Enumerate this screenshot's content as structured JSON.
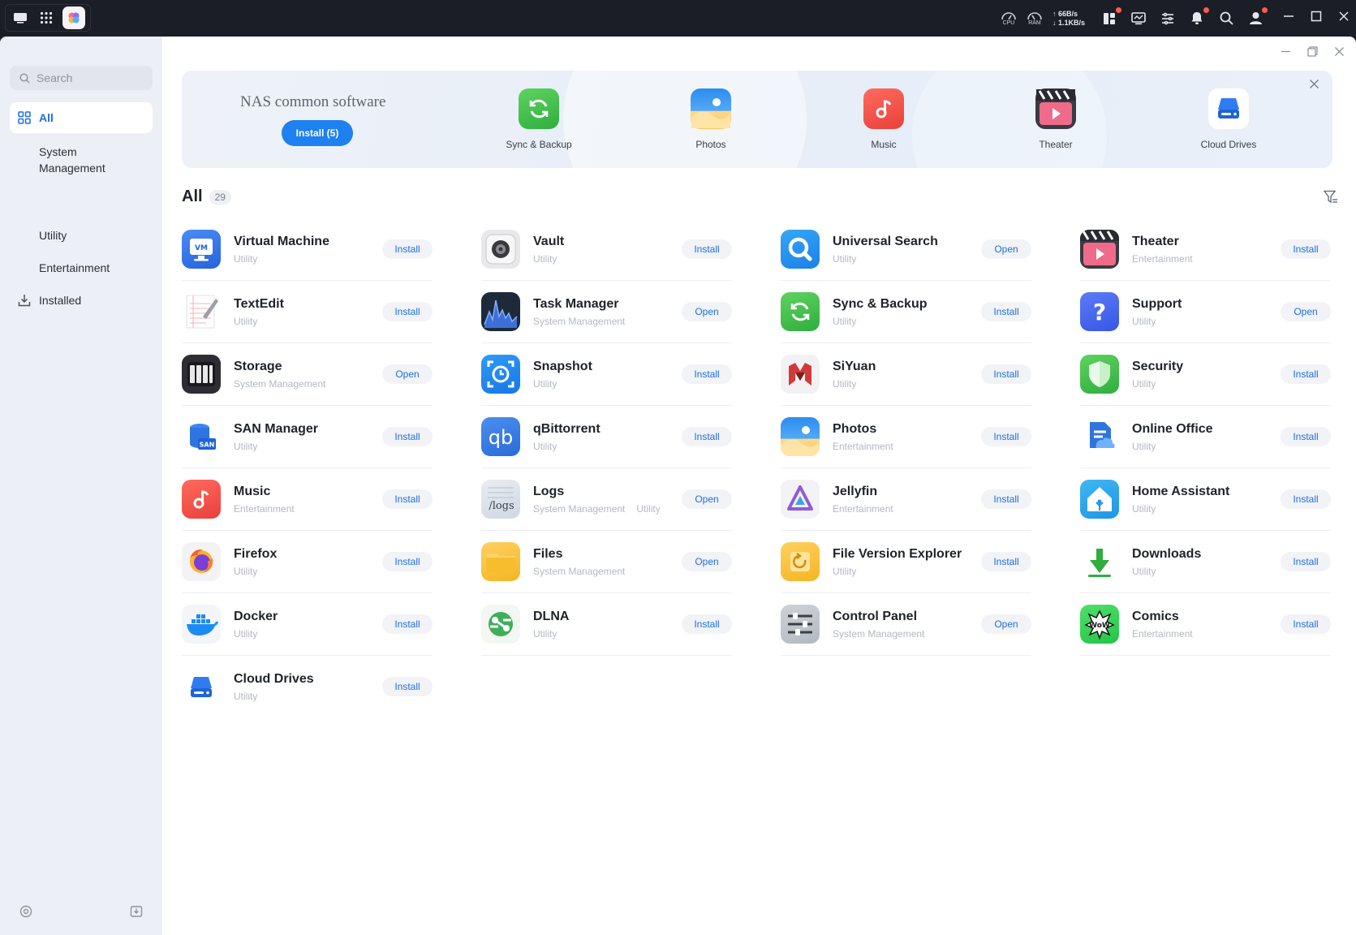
{
  "taskbar": {
    "cpu_label": "CPU",
    "ram_label": "RAM",
    "net_up": "↑ 66B/s",
    "net_down": "↓ 1.1KB/s"
  },
  "sidebar": {
    "search_placeholder": "Search",
    "items": [
      {
        "label": "All"
      },
      {
        "label": "System Management"
      },
      {
        "label": "Utility"
      },
      {
        "label": "Entertainment"
      },
      {
        "label": "Installed"
      }
    ]
  },
  "banner": {
    "title": "NAS common software",
    "install_label": "Install (5)",
    "apps": [
      {
        "label": "Sync & Backup",
        "icon": "sync-backup-icon"
      },
      {
        "label": "Photos",
        "icon": "photos-icon"
      },
      {
        "label": "Music",
        "icon": "music-icon"
      },
      {
        "label": "Theater",
        "icon": "theater-icon"
      },
      {
        "label": "Cloud Drives",
        "icon": "cloud-drives-icon"
      }
    ]
  },
  "list": {
    "title": "All",
    "count": "29",
    "apps": [
      {
        "name": "Virtual Machine",
        "cat": "Utility",
        "cat2": "",
        "action": "Install",
        "icon": "vm"
      },
      {
        "name": "Vault",
        "cat": "Utility",
        "cat2": "",
        "action": "Install",
        "icon": "vault"
      },
      {
        "name": "Universal Search",
        "cat": "Utility",
        "cat2": "",
        "action": "Open",
        "icon": "search"
      },
      {
        "name": "Theater",
        "cat": "Entertainment",
        "cat2": "",
        "action": "Install",
        "icon": "theater"
      },
      {
        "name": "TextEdit",
        "cat": "Utility",
        "cat2": "",
        "action": "Install",
        "icon": "textedit"
      },
      {
        "name": "Task Manager",
        "cat": "System Management",
        "cat2": "",
        "action": "Open",
        "icon": "taskmgr"
      },
      {
        "name": "Sync & Backup",
        "cat": "Utility",
        "cat2": "",
        "action": "Install",
        "icon": "sync"
      },
      {
        "name": "Support",
        "cat": "Utility",
        "cat2": "",
        "action": "Open",
        "icon": "support"
      },
      {
        "name": "Storage",
        "cat": "System Management",
        "cat2": "",
        "action": "Open",
        "icon": "storage"
      },
      {
        "name": "Snapshot",
        "cat": "Utility",
        "cat2": "",
        "action": "Install",
        "icon": "snapshot"
      },
      {
        "name": "SiYuan",
        "cat": "Utility",
        "cat2": "",
        "action": "Install",
        "icon": "siyuan"
      },
      {
        "name": "Security",
        "cat": "Utility",
        "cat2": "",
        "action": "Install",
        "icon": "security"
      },
      {
        "name": "SAN Manager",
        "cat": "Utility",
        "cat2": "",
        "action": "Install",
        "icon": "san"
      },
      {
        "name": "qBittorrent",
        "cat": "Utility",
        "cat2": "",
        "action": "Install",
        "icon": "qbit"
      },
      {
        "name": "Photos",
        "cat": "Entertainment",
        "cat2": "",
        "action": "Install",
        "icon": "photos"
      },
      {
        "name": "Online Office",
        "cat": "Utility",
        "cat2": "",
        "action": "Install",
        "icon": "office"
      },
      {
        "name": "Music",
        "cat": "Entertainment",
        "cat2": "",
        "action": "Install",
        "icon": "music"
      },
      {
        "name": "Logs",
        "cat": "System Management",
        "cat2": "Utility",
        "action": "Open",
        "icon": "logs"
      },
      {
        "name": "Jellyfin",
        "cat": "Entertainment",
        "cat2": "",
        "action": "Install",
        "icon": "jellyfin"
      },
      {
        "name": "Home Assistant",
        "cat": "Utility",
        "cat2": "",
        "action": "Install",
        "icon": "homeassistant"
      },
      {
        "name": "Firefox",
        "cat": "Utility",
        "cat2": "",
        "action": "Install",
        "icon": "firefox"
      },
      {
        "name": "Files",
        "cat": "System Management",
        "cat2": "",
        "action": "Open",
        "icon": "files"
      },
      {
        "name": "File Version Explorer",
        "cat": "Utility",
        "cat2": "",
        "action": "Install",
        "icon": "fileversion"
      },
      {
        "name": "Downloads",
        "cat": "Utility",
        "cat2": "",
        "action": "Install",
        "icon": "downloads"
      },
      {
        "name": "Docker",
        "cat": "Utility",
        "cat2": "",
        "action": "Install",
        "icon": "docker"
      },
      {
        "name": "DLNA",
        "cat": "Utility",
        "cat2": "",
        "action": "Install",
        "icon": "dlna"
      },
      {
        "name": "Control Panel",
        "cat": "System Management",
        "cat2": "",
        "action": "Open",
        "icon": "controlpanel"
      },
      {
        "name": "Comics",
        "cat": "Entertainment",
        "cat2": "",
        "action": "Install",
        "icon": "comics"
      },
      {
        "name": "Cloud Drives",
        "cat": "Utility",
        "cat2": "",
        "action": "Install",
        "icon": "clouddrives"
      }
    ]
  },
  "colors": {
    "accent": "#1f6fe0",
    "button_primary": "#1f80f0",
    "sidebar_bg": "#eceff5",
    "taskbar_bg": "#1b1e26"
  }
}
